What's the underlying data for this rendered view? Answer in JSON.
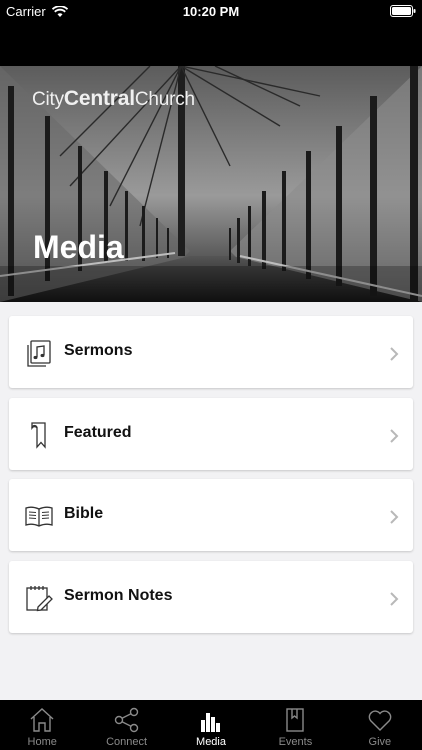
{
  "status_bar": {
    "carrier": "Carrier",
    "time": "10:20 PM"
  },
  "hero": {
    "brand": {
      "light1": "City",
      "bold": "Central",
      "light2": "Church"
    },
    "title": "Media"
  },
  "items": [
    {
      "label": "Sermons",
      "icon": "music-notes-icon"
    },
    {
      "label": "Featured",
      "icon": "bookmark-icon"
    },
    {
      "label": "Bible",
      "icon": "open-book-icon"
    },
    {
      "label": "Sermon Notes",
      "icon": "notepad-pencil-icon"
    }
  ],
  "tabs": [
    {
      "label": "Home",
      "icon": "home-icon",
      "active": false
    },
    {
      "label": "Connect",
      "icon": "share-icon",
      "active": false
    },
    {
      "label": "Media",
      "icon": "equalizer-icon",
      "active": true
    },
    {
      "label": "Events",
      "icon": "calendar-icon",
      "active": false
    },
    {
      "label": "Give",
      "icon": "heart-icon",
      "active": false
    }
  ],
  "colors": {
    "tab_inactive": "#8a8a8a",
    "tab_active": "#ffffff",
    "background": "#f2f2f4"
  }
}
